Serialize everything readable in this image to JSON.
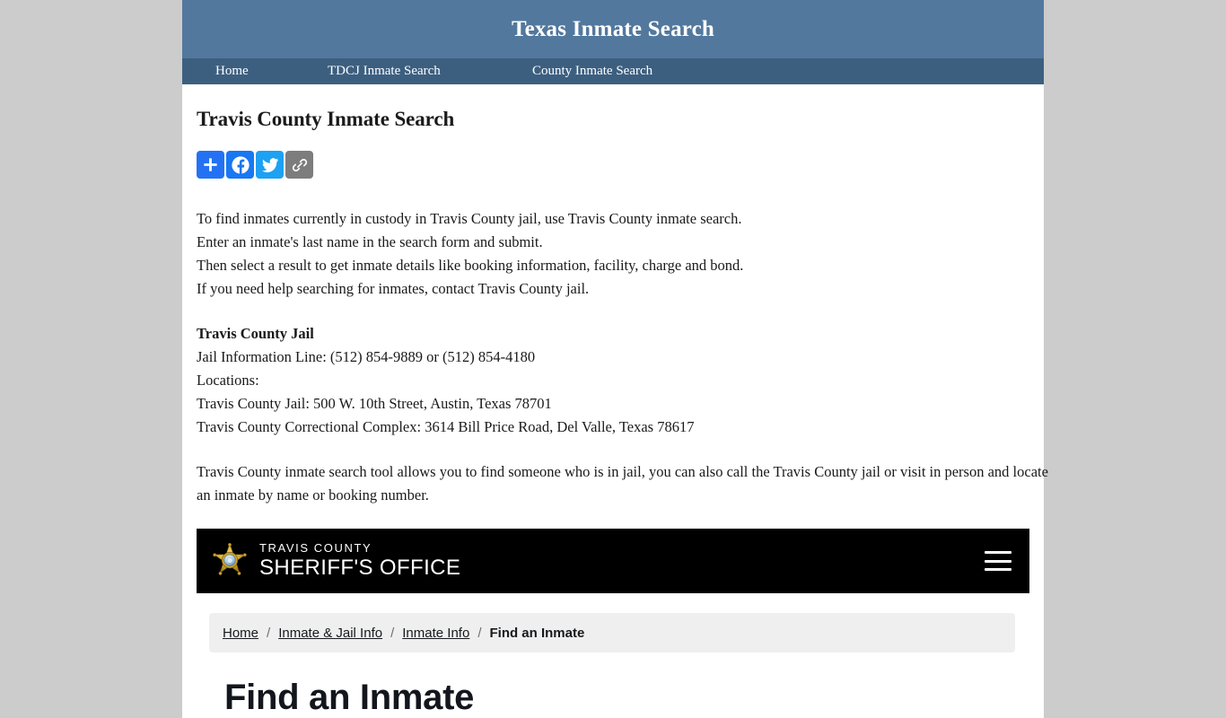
{
  "site": {
    "title": "Texas Inmate Search",
    "nav": [
      {
        "label": "Home",
        "name": "nav-home"
      },
      {
        "label": "TDCJ Inmate Search",
        "name": "nav-tdcj-inmate-search"
      },
      {
        "label": "County Inmate Search",
        "name": "nav-county-inmate-search"
      }
    ],
    "header_bg": "#52789e",
    "nav_bg": "#3c5f80",
    "page_bg": "#cccccc"
  },
  "article": {
    "title": "Travis County Inmate Search",
    "share": [
      {
        "name": "addthis-share-icon",
        "label": "Share",
        "color": "#2472f3"
      },
      {
        "name": "facebook-share-icon",
        "label": "Facebook",
        "color": "#1877f2"
      },
      {
        "name": "twitter-share-icon",
        "label": "Twitter",
        "color": "#1da1f2"
      },
      {
        "name": "copy-link-icon",
        "label": "Copy Link",
        "color": "#7d7d7d"
      }
    ],
    "intro": {
      "line1": "To find inmates currently in custody in Travis County jail, use Travis County inmate search.",
      "line2": "Enter an inmate's last name in the search form and submit.",
      "line3": "Then select a result to get inmate details like booking information, facility, charge and bond.",
      "line4": "If you need help searching for inmates, contact Travis County jail."
    },
    "jail": {
      "heading": "Travis County Jail",
      "info_line": "Jail Information Line: (512) 854-9889 or (512) 854-4180",
      "locations_label": "Locations:",
      "location1": "Travis County Jail: 500 W. 10th Street, Austin, Texas 78701",
      "location2": "Travis County Correctional Complex: 3614 Bill Price Road, Del Valle, Texas 78617"
    },
    "tool_text": "Travis County inmate search tool allows you to find someone who is in jail, you can also call the Travis County jail or visit in person and locate an inmate by name or booking number."
  },
  "embed": {
    "banner": {
      "bg": "#000000",
      "county": "TRAVIS COUNTY",
      "office": "SHERIFF'S OFFICE",
      "badge_name": "sheriff-star-badge-icon",
      "menu_name": "hamburger-menu-icon"
    },
    "breadcrumb": {
      "bg": "#efefef",
      "separator": "/",
      "items": [
        {
          "label": "Home",
          "current": false
        },
        {
          "label": "Inmate & Jail Info",
          "current": false
        },
        {
          "label": "Inmate Info",
          "current": false
        },
        {
          "label": "Find an Inmate",
          "current": true
        }
      ]
    },
    "page_title": "Find an Inmate"
  }
}
